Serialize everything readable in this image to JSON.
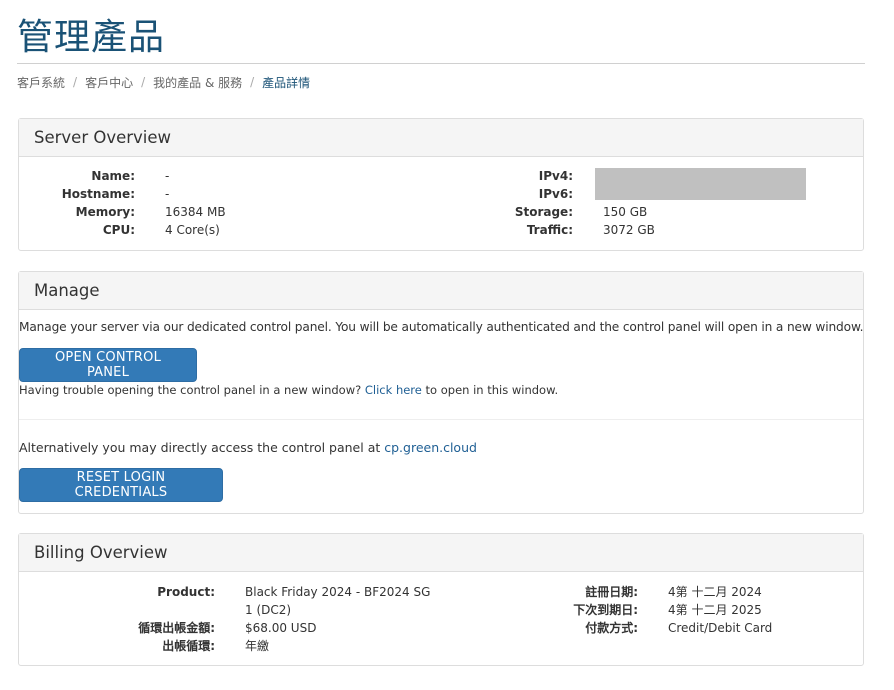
{
  "page": {
    "title": "管理產品"
  },
  "breadcrumb": [
    {
      "label": "客戶系統"
    },
    {
      "label": "客戶中心"
    },
    {
      "label": "我的產品 & 服務"
    },
    {
      "label": "產品詳情"
    }
  ],
  "server_overview": {
    "heading": "Server Overview",
    "name_label": "Name:",
    "name_value": "-",
    "hostname_label": "Hostname:",
    "hostname_value": "-",
    "memory_label": "Memory:",
    "memory_value": "16384 MB",
    "cpu_label": "CPU:",
    "cpu_value": "4 Core(s)",
    "ipv4_label": "IPv4:",
    "ipv6_label": "IPv6:",
    "storage_label": "Storage:",
    "storage_value": "150 GB",
    "traffic_label": "Traffic:",
    "traffic_value": "3072 GB"
  },
  "manage": {
    "heading": "Manage",
    "intro": "Manage your server via our dedicated control panel. You will be automatically authenticated and the control panel will open in a new window.",
    "open_button": "OPEN CONTROL PANEL",
    "trouble_prefix": "Having trouble opening the control panel in a new window? ",
    "click_here": "Click here",
    "trouble_suffix": " to open in this window.",
    "alt_prefix": "Alternatively you may directly access the control panel at ",
    "alt_link": "cp.green.cloud",
    "reset_button": "RESET LOGIN CREDENTIALS"
  },
  "billing": {
    "heading": "Billing Overview",
    "product_label": "Product:",
    "product_value_line1": "Black Friday 2024 - BF2024 SG",
    "product_value_line2": "1 (DC2)",
    "recurring_label": "循環出帳金額:",
    "recurring_value": "$68.00 USD",
    "cycle_label": "出帳循環:",
    "cycle_value": "年繳",
    "reg_label": "註冊日期:",
    "reg_value": "4第 十二月 2024",
    "due_label": "下次到期日:",
    "due_value": "4第 十二月 2025",
    "payment_label": "付款方式:",
    "payment_value": "Credit/Debit Card"
  }
}
